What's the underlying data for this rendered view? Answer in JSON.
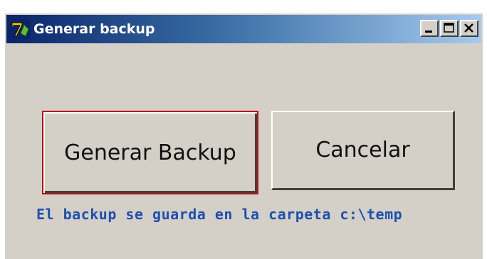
{
  "window": {
    "title": "Generar backup",
    "app_icon": "7zip-icon",
    "controls": {
      "minimize_icon": "minimize-icon",
      "maximize_icon": "maximize-icon",
      "close_icon": "close-icon"
    }
  },
  "buttons": {
    "generate_label": "Generar Backup",
    "cancel_label": "Cancelar"
  },
  "info_text": "El backup se guarda en la carpeta c:\\temp",
  "colors": {
    "title_gradient_start": "#0a246a",
    "title_gradient_end": "#a6caf0",
    "window_bg": "#d4d0c8",
    "focus_border": "#b81010",
    "info_text": "#1f4fb0"
  }
}
